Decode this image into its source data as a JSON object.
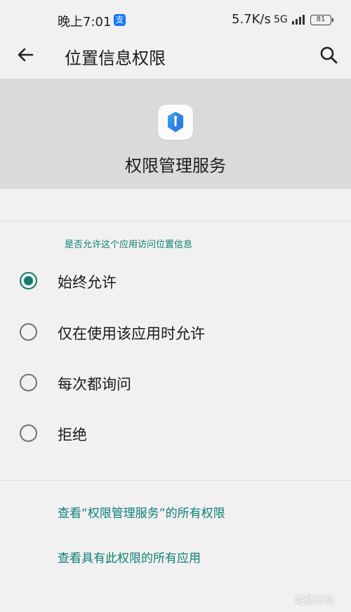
{
  "status_bar": {
    "time": "晚上7:01",
    "alipay_glyph": "支",
    "speed": "5.7K/s",
    "network": "5G",
    "battery": "81"
  },
  "app_bar": {
    "title": "位置信息权限",
    "back_icon": "arrow-left-icon",
    "search_icon": "search-icon"
  },
  "app_header": {
    "app_name": "权限管理服务",
    "app_icon": "shield-icon"
  },
  "permission": {
    "question": "是否允许这个应用访问位置信息",
    "options": [
      {
        "label": "始终允许",
        "checked": true
      },
      {
        "label": "仅在使用该应用时允许",
        "checked": false
      },
      {
        "label": "每次都询问",
        "checked": false
      },
      {
        "label": "拒绝",
        "checked": false
      }
    ]
  },
  "links": {
    "view_all_permissions": "查看“权限管理服务”的所有权限",
    "view_all_apps": "查看具有此权限的所有应用"
  },
  "watermark": "骷髅玩机",
  "colors": {
    "accent": "#147a6c",
    "link": "#0f8074",
    "header_band": "#dadada",
    "background": "#f1f1f1"
  }
}
